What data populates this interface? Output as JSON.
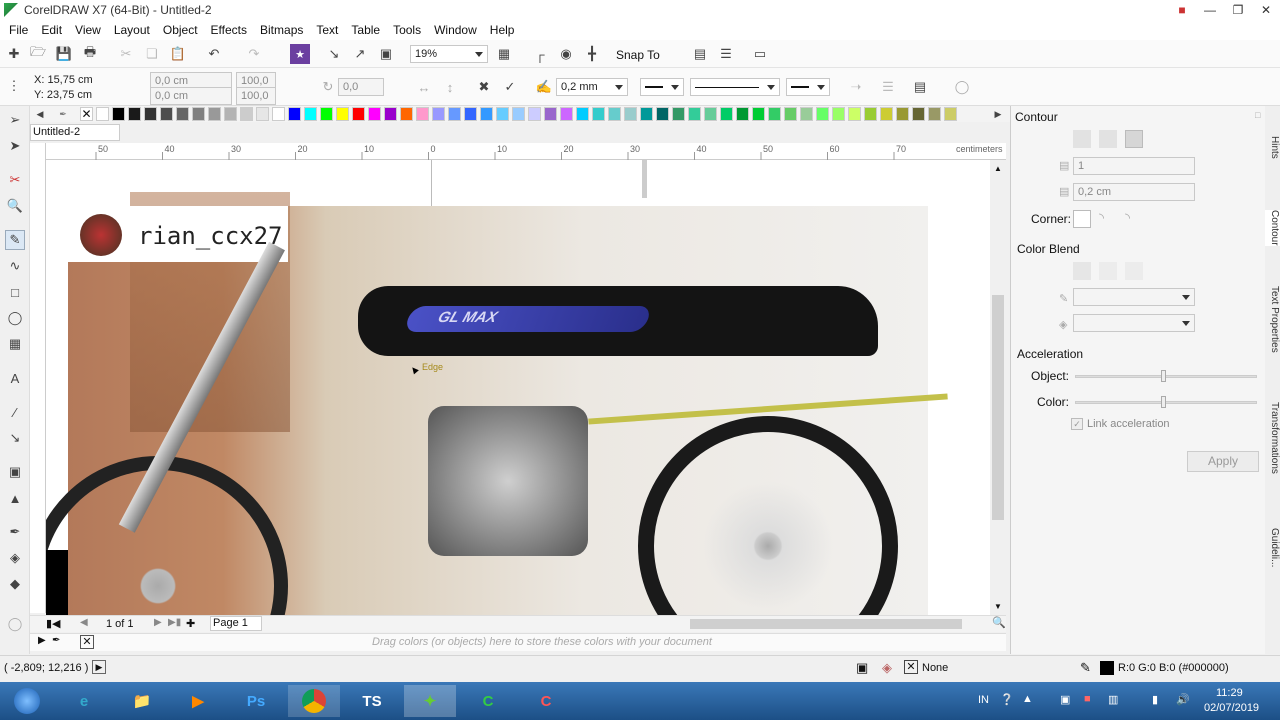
{
  "window": {
    "title": "CorelDRAW X7 (64-Bit) - Untitled-2"
  },
  "menu": [
    "File",
    "Edit",
    "View",
    "Layout",
    "Object",
    "Effects",
    "Bitmaps",
    "Text",
    "Table",
    "Tools",
    "Window",
    "Help"
  ],
  "toolbar": {
    "zoom": "19%",
    "snap_to": "Snap To"
  },
  "propbar": {
    "x": "X: 15,75 cm",
    "y": "Y: 23,75 cm",
    "w": "0,0 cm",
    "h": "0,0 cm",
    "scale_w": "100,0",
    "scale_h": "100,0",
    "angle": "0,0",
    "outline_width": "0,2 mm"
  },
  "document": {
    "tab": "Untitled-2",
    "page_label": "Page 1",
    "page_count": "1 of 1"
  },
  "ruler": {
    "h_ticks": [
      "50",
      "40",
      "30",
      "20",
      "10",
      "0",
      "10",
      "20",
      "30",
      "40",
      "50",
      "60",
      "70"
    ],
    "unit": "centimeters"
  },
  "image": {
    "watermark": "rian_ccx27",
    "bike_brand": "GL MAX"
  },
  "cursor_label": "Edge",
  "colorwell_hint": "Drag colors (or objects) here to store these colors with your document",
  "status": {
    "coords": "( -2,809; 12,216 )",
    "fill": "None",
    "outline": "R:0 G:0 B:0 (#000000)"
  },
  "docker": {
    "title": "Contour",
    "steps": "1",
    "offset": "0,2 cm",
    "corner_label": "Corner:",
    "color_blend_label": "Color Blend",
    "acceleration_label": "Acceleration",
    "object_label": "Object:",
    "color_label": "Color:",
    "link_label": "Link acceleration",
    "apply_label": "Apply",
    "tabs": [
      "Hints",
      "Contour",
      "Text Properties",
      "Transformations",
      "Guideli..."
    ]
  },
  "palette": [
    "#ffffff",
    "#000000",
    "#1a1a1a",
    "#333333",
    "#4d4d4d",
    "#666666",
    "#808080",
    "#999999",
    "#b3b3b3",
    "#cccccc",
    "#e6e6e6",
    "#ffffff",
    "#0000ff",
    "#00ffff",
    "#00ff00",
    "#ffff00",
    "#ff0000",
    "#ff00ff",
    "#9900cc",
    "#ff6600",
    "#ff99cc",
    "#9999ff",
    "#6699ff",
    "#3366ff",
    "#3399ff",
    "#66ccff",
    "#99ccff",
    "#ccccff",
    "#9966cc",
    "#cc66ff",
    "#00ccff",
    "#33cccc",
    "#66cccc",
    "#99cccc",
    "#009999",
    "#006666",
    "#339966",
    "#33cc99",
    "#66cc99",
    "#00cc66",
    "#009933",
    "#00cc33",
    "#33cc66",
    "#66cc66",
    "#99cc99",
    "#66ff66",
    "#99ff66",
    "#ccff66",
    "#99cc33",
    "#cccc33",
    "#999933",
    "#666633",
    "#999966",
    "#cccc66"
  ],
  "taskbar": {
    "apps": [
      "IE",
      "Explorer",
      "Media",
      "Ps",
      "Chrome",
      "TSC",
      "CorelDRAW",
      "Camtasia",
      "Recorder"
    ],
    "time": "11:29",
    "date": "02/07/2019",
    "lang": "IN"
  },
  "colors": {
    "accent": "#1c4f86",
    "selection": "#000000"
  }
}
